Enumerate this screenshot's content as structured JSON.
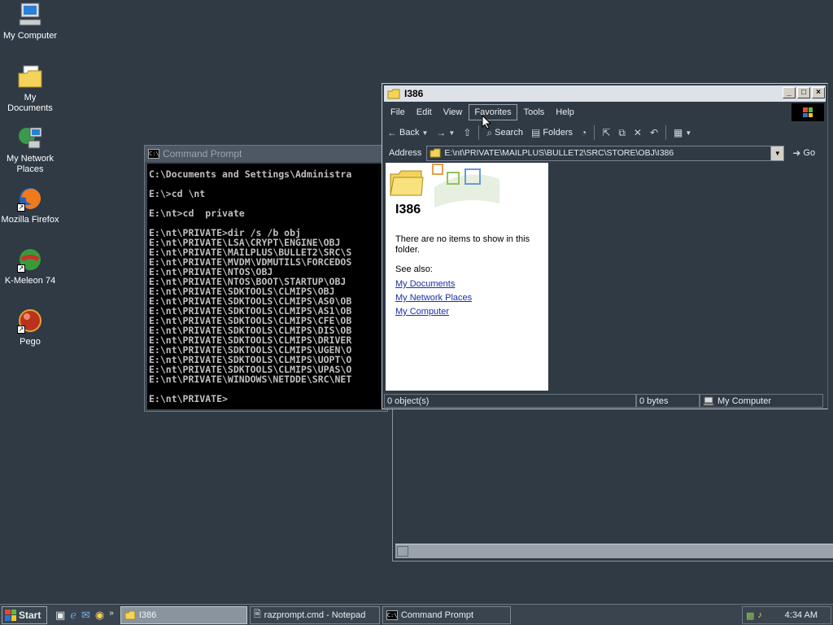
{
  "desktop": {
    "icons": [
      {
        "label": "My Computer",
        "icon": "my-computer-icon"
      },
      {
        "label": "My Documents",
        "icon": "my-documents-icon"
      },
      {
        "label": "My Network Places",
        "icon": "network-places-icon"
      },
      {
        "label": "Mozilla Firefox",
        "icon": "firefox-icon"
      },
      {
        "label": "K-Meleon 74",
        "icon": "kmeleon-icon"
      },
      {
        "label": "Pego",
        "icon": "pego-icon"
      }
    ]
  },
  "cmd": {
    "title": "Command Prompt",
    "lines": [
      "C:\\Documents and Settings\\Administra",
      "",
      "E:\\>cd \\nt",
      "",
      "E:\\nt>cd  private",
      "",
      "E:\\nt\\PRIVATE>dir /s /b obj",
      "E:\\nt\\PRIVATE\\LSA\\CRYPT\\ENGINE\\OBJ",
      "E:\\nt\\PRIVATE\\MAILPLUS\\BULLET2\\SRC\\S",
      "E:\\nt\\PRIVATE\\MVDM\\VDMUTILS\\FORCEDOS",
      "E:\\nt\\PRIVATE\\NTOS\\OBJ",
      "E:\\nt\\PRIVATE\\NTOS\\BOOT\\STARTUP\\OBJ",
      "E:\\nt\\PRIVATE\\SDKTOOLS\\CLMIPS\\OBJ",
      "E:\\nt\\PRIVATE\\SDKTOOLS\\CLMIPS\\AS0\\OB",
      "E:\\nt\\PRIVATE\\SDKTOOLS\\CLMIPS\\AS1\\OB",
      "E:\\nt\\PRIVATE\\SDKTOOLS\\CLMIPS\\CFE\\OB",
      "E:\\nt\\PRIVATE\\SDKTOOLS\\CLMIPS\\DIS\\OB",
      "E:\\nt\\PRIVATE\\SDKTOOLS\\CLMIPS\\DRIVER",
      "E:\\nt\\PRIVATE\\SDKTOOLS\\CLMIPS\\UGEN\\O",
      "E:\\nt\\PRIVATE\\SDKTOOLS\\CLMIPS\\UOPT\\O",
      "E:\\nt\\PRIVATE\\SDKTOOLS\\CLMIPS\\UPAS\\O",
      "E:\\nt\\PRIVATE\\WINDOWS\\NETDDE\\SRC\\NET",
      "",
      "E:\\nt\\PRIVATE>"
    ]
  },
  "explorer": {
    "title": "I386",
    "menu": [
      "File",
      "Edit",
      "View",
      "Favorites",
      "Tools",
      "Help"
    ],
    "toolbar": {
      "back": "Back",
      "search": "Search",
      "folders": "Folders"
    },
    "address_label": "Address",
    "address_value": "E:\\nt\\PRIVATE\\MAILPLUS\\BULLET2\\SRC\\STORE\\OBJ\\I386",
    "go": "Go",
    "pane": {
      "title": "I386",
      "empty_message": "There are no items to show in this folder.",
      "see_also": "See also:",
      "links": [
        "My Documents",
        "My Network Places",
        "My Computer"
      ]
    },
    "status": {
      "objects": "0 object(s)",
      "size": "0 bytes",
      "location": "My Computer"
    }
  },
  "taskbar": {
    "start": "Start",
    "tasks": [
      {
        "label": "I386",
        "active": true
      },
      {
        "label": "razprompt.cmd - Notepad",
        "active": false
      },
      {
        "label": "Command Prompt",
        "active": false
      }
    ],
    "clock": "4:34 AM"
  },
  "colors": {
    "desktop": "#2f3a45",
    "link": "#1a2fa8",
    "active_task": "#8a949e"
  }
}
